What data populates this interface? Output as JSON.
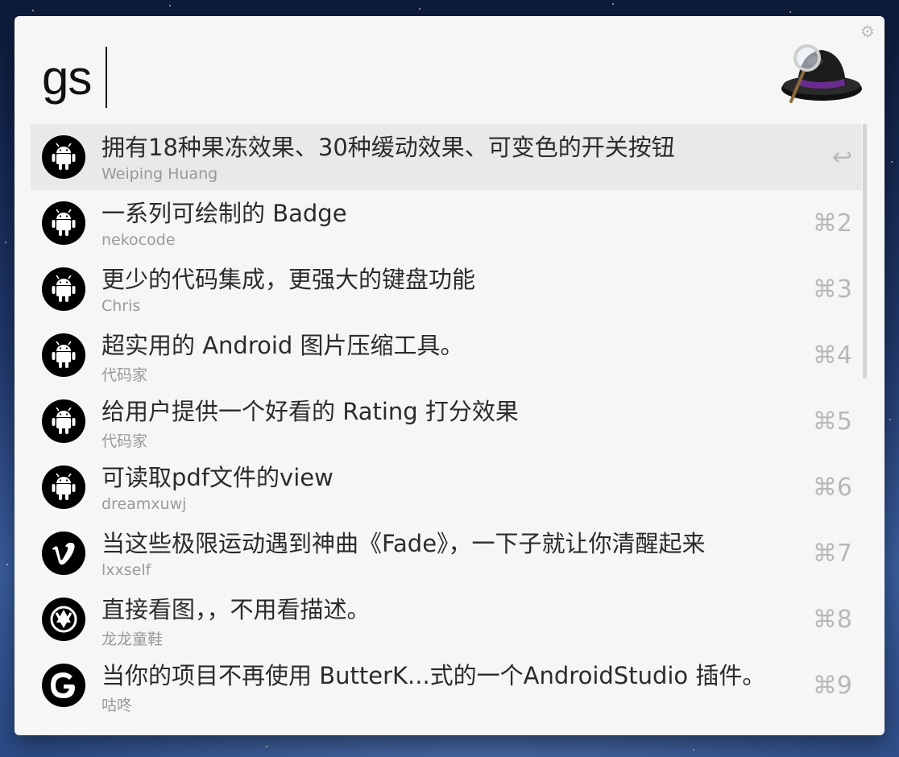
{
  "search": {
    "query": "gs"
  },
  "results": [
    {
      "title": "拥有18种果冻效果、30种缓动效果、可变色的开关按钮",
      "subtitle": "Weiping Huang",
      "shortcut": "↩",
      "icon": "android-icon"
    },
    {
      "title": "一系列可绘制的 Badge",
      "subtitle": "nekocode",
      "shortcut": "⌘2",
      "icon": "android-icon"
    },
    {
      "title": "更少的代码集成，更强大的键盘功能",
      "subtitle": "Chris",
      "shortcut": "⌘3",
      "icon": "android-icon"
    },
    {
      "title": "超实用的 Android 图片压缩工具。",
      "subtitle": "代码家",
      "shortcut": "⌘4",
      "icon": "android-icon"
    },
    {
      "title": "给用户提供一个好看的 Rating 打分效果",
      "subtitle": "代码家",
      "shortcut": "⌘5",
      "icon": "android-icon"
    },
    {
      "title": "可读取pdf文件的view",
      "subtitle": "dreamxuwj",
      "shortcut": "⌘6",
      "icon": "android-icon"
    },
    {
      "title": "当这些极限运动遇到神曲《Fade》，一下子就让你清醒起来",
      "subtitle": "lxxself",
      "shortcut": "⌘7",
      "icon": "vimeo-icon"
    },
    {
      "title": "直接看图，，不用看描述。",
      "subtitle": "龙龙童鞋",
      "shortcut": "⌘8",
      "icon": "picasa-icon"
    },
    {
      "title": "当你的项目不再使用 ButterK...式的一个AndroidStudio 插件。",
      "subtitle": "咕咚",
      "shortcut": "⌘9",
      "icon": "google-icon"
    }
  ],
  "colors": {
    "selection": "#e9e9e9",
    "panel": "#f6f6f6",
    "title_text": "#2b2b2b",
    "subtitle_text": "#9a9a9a",
    "shortcut_text": "#b8b8b8"
  }
}
